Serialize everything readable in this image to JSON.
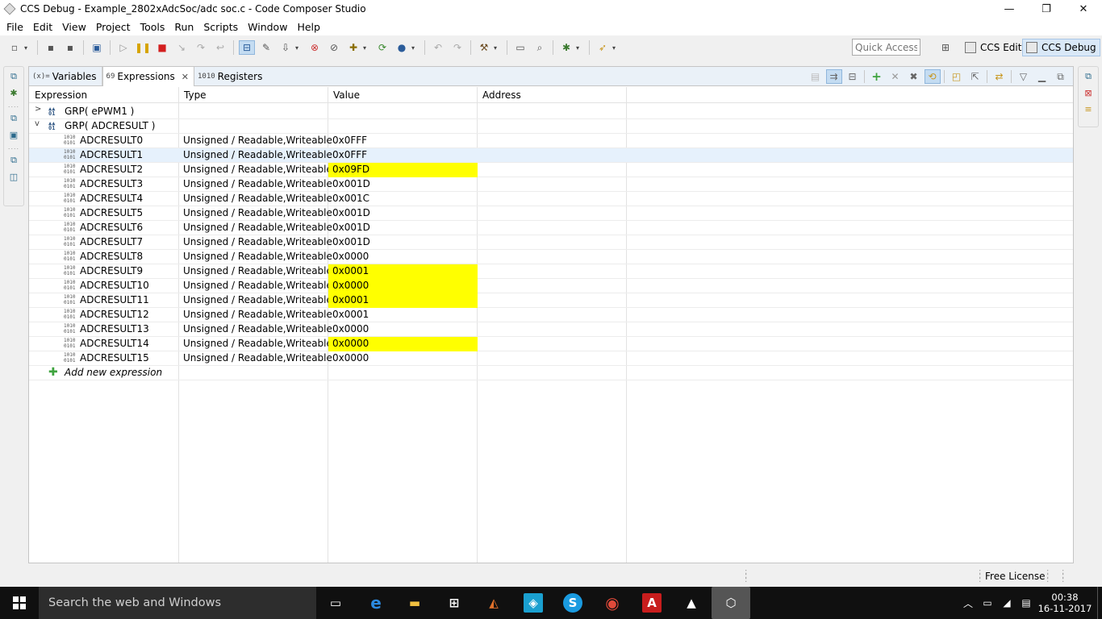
{
  "window": {
    "title": "CCS Debug - Example_2802xAdcSoc/adc soc.c - Code Composer Studio",
    "minimize_glyph": "—",
    "maximize_glyph": "❐",
    "close_glyph": "✕"
  },
  "menubar": [
    "File",
    "Edit",
    "View",
    "Project",
    "Tools",
    "Run",
    "Scripts",
    "Window",
    "Help"
  ],
  "toolbar": {
    "quick_access_placeholder": "Quick Access",
    "perspectives": [
      {
        "label": "CCS Edit",
        "active": false
      },
      {
        "label": "CCS Debug",
        "active": true
      }
    ]
  },
  "view": {
    "tabs": [
      {
        "icon": "(x)=",
        "label": "Variables",
        "active": false
      },
      {
        "icon": "69",
        "label": "Expressions",
        "active": true,
        "close": "✕"
      },
      {
        "icon": "1010",
        "label": "Registers",
        "active": false
      }
    ],
    "columns": [
      "Expression",
      "Type",
      "Value",
      "Address"
    ],
    "groups": [
      {
        "name": "GRP( ePWM1 )",
        "expanded": false
      },
      {
        "name": "GRP( ADCRESULT )",
        "expanded": true
      }
    ],
    "rows": [
      {
        "expression": "ADCRESULT0",
        "type": "Unsigned / Readable,Writeable",
        "value": "0x0FFF",
        "changed": false,
        "selected": false
      },
      {
        "expression": "ADCRESULT1",
        "type": "Unsigned / Readable,Writeable",
        "value": "0x0FFF",
        "changed": false,
        "selected": true
      },
      {
        "expression": "ADCRESULT2",
        "type": "Unsigned / Readable,Writeable",
        "value": "0x09FD",
        "changed": true,
        "selected": false
      },
      {
        "expression": "ADCRESULT3",
        "type": "Unsigned / Readable,Writeable",
        "value": "0x001D",
        "changed": false,
        "selected": false
      },
      {
        "expression": "ADCRESULT4",
        "type": "Unsigned / Readable,Writeable",
        "value": "0x001C",
        "changed": false,
        "selected": false
      },
      {
        "expression": "ADCRESULT5",
        "type": "Unsigned / Readable,Writeable",
        "value": "0x001D",
        "changed": false,
        "selected": false
      },
      {
        "expression": "ADCRESULT6",
        "type": "Unsigned / Readable,Writeable",
        "value": "0x001D",
        "changed": false,
        "selected": false
      },
      {
        "expression": "ADCRESULT7",
        "type": "Unsigned / Readable,Writeable",
        "value": "0x001D",
        "changed": false,
        "selected": false
      },
      {
        "expression": "ADCRESULT8",
        "type": "Unsigned / Readable,Writeable",
        "value": "0x0000",
        "changed": false,
        "selected": false
      },
      {
        "expression": "ADCRESULT9",
        "type": "Unsigned / Readable,Writeable",
        "value": "0x0001",
        "changed": true,
        "selected": false
      },
      {
        "expression": "ADCRESULT10",
        "type": "Unsigned / Readable,Writeable",
        "value": "0x0000",
        "changed": true,
        "selected": false
      },
      {
        "expression": "ADCRESULT11",
        "type": "Unsigned / Readable,Writeable",
        "value": "0x0001",
        "changed": true,
        "selected": false
      },
      {
        "expression": "ADCRESULT12",
        "type": "Unsigned / Readable,Writeable",
        "value": "0x0001",
        "changed": false,
        "selected": false
      },
      {
        "expression": "ADCRESULT13",
        "type": "Unsigned / Readable,Writeable",
        "value": "0x0000",
        "changed": false,
        "selected": false
      },
      {
        "expression": "ADCRESULT14",
        "type": "Unsigned / Readable,Writeable",
        "value": "0x0000",
        "changed": true,
        "selected": false
      },
      {
        "expression": "ADCRESULT15",
        "type": "Unsigned / Readable,Writeable",
        "value": "0x0000",
        "changed": false,
        "selected": false
      }
    ],
    "add_new_expression": "Add new expression"
  },
  "statusbar": {
    "license": "Free License"
  },
  "taskbar": {
    "search_placeholder": "Search the web and Windows",
    "time": "00:38",
    "date": "16-11-2017"
  },
  "colors": {
    "changed_value_bg": "#ffff00",
    "selected_row_bg": "#e6f1fc",
    "tab_bar_bg": "#eaf1f8",
    "taskbar_bg": "#101010"
  }
}
